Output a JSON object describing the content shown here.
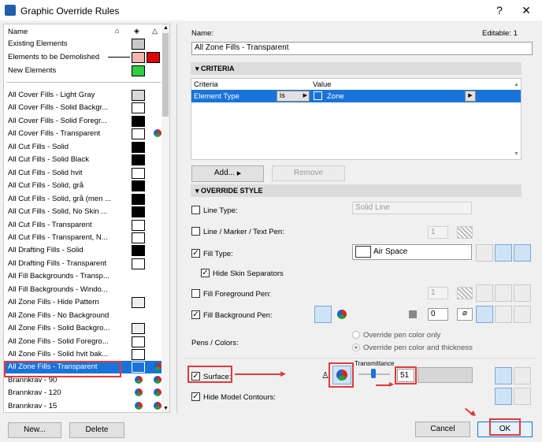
{
  "window": {
    "title": "Graphic Override Rules",
    "help": "?",
    "close": "✕"
  },
  "list": {
    "header": "Name",
    "top": [
      {
        "label": "Existing Elements",
        "swatch": "#c8c8c8"
      },
      {
        "label": "Elements to be Demolished",
        "swatch": "#f4b4b4",
        "extra": "#e00000"
      },
      {
        "label": "New Elements",
        "swatch": "#2ecc40"
      }
    ],
    "items": [
      {
        "label": "All Cover Fills - Light Gray",
        "swatch": "#d8d8d8"
      },
      {
        "label": "All Cover Fills - Solid Backgr...",
        "swatch": "#ffffff"
      },
      {
        "label": "All Cover Fills - Solid Foregr...",
        "swatch": "#000000"
      },
      {
        "label": "All Cover Fills - Transparent",
        "swatch": "#ffffff",
        "pie": true
      },
      {
        "label": "All Cut Fills - Solid",
        "swatch": "#000000"
      },
      {
        "label": "All Cut Fills - Solid Black",
        "swatch": "#000000"
      },
      {
        "label": "All Cut Fills - Solid hvit",
        "swatch": "#ffffff"
      },
      {
        "label": "All Cut Fills - Solid, grå",
        "swatch": "#000000"
      },
      {
        "label": "All Cut Fills - Solid, grå (men ...",
        "swatch": "#000000"
      },
      {
        "label": "All Cut Fills - Solid, No Skin ...",
        "swatch": "#000000"
      },
      {
        "label": "All Cut Fills - Transparent",
        "swatch": "#ffffff"
      },
      {
        "label": "All Cut Fills - Transparent, N...",
        "swatch": "#ffffff"
      },
      {
        "label": "All Drafting Fills - Solid",
        "swatch": "#000000"
      },
      {
        "label": "All Drafting Fills - Transparent",
        "swatch": "#ffffff"
      },
      {
        "label": "All Fill Backgrounds - Transp...",
        "swatch": ""
      },
      {
        "label": "All Fill Backgrounds - Windo...",
        "swatch": ""
      },
      {
        "label": "All Zone Fills - Hide Pattern",
        "swatch": "#eeeeee"
      },
      {
        "label": "All Zone Fills - No Background",
        "swatch": ""
      },
      {
        "label": "All Zone Fills - Solid Backgro...",
        "swatch": "#eeeeee"
      },
      {
        "label": "All Zone Fills - Solid Foregro...",
        "swatch": "#ffffff"
      },
      {
        "label": "All Zone Fills - Solid hvit bak...",
        "swatch": "#ffffff"
      },
      {
        "label": "All Zone Fills - Transparent",
        "swatch": "#1a73d9",
        "pie": true,
        "selected": true
      },
      {
        "label": "Brannkrav - 90",
        "swatch": "",
        "pie2": true
      },
      {
        "label": "Brannkrav - 120",
        "swatch": "",
        "pie2": true
      },
      {
        "label": "Brannkrav - 15",
        "swatch": "",
        "pie2": true
      }
    ],
    "new_btn": "New...",
    "delete_btn": "Delete"
  },
  "detail": {
    "name_label": "Name:",
    "editable": "Editable: 1",
    "name_value": "All Zone Fills - Transparent",
    "criteria_head": "CRITERIA",
    "col_criteria": "Criteria",
    "col_value": "Value",
    "crit_row": {
      "criteria": "Element Type",
      "op": "is",
      "value": "Zone"
    },
    "add_btn": "Add...",
    "remove_btn": "Remove",
    "override_head": "OVERRIDE STYLE",
    "line_type": "Line Type:",
    "line_type_val": "Solid Line",
    "pen": "Line / Marker / Text Pen:",
    "pen_val": "1",
    "fill_type": "Fill Type:",
    "fill_type_val": "Air Space",
    "hide_skin": "Hide Skin Separators",
    "fg_pen": "Fill Foreground Pen:",
    "fg_pen_val": "1",
    "bg_pen": "Fill Background Pen:",
    "bg_pen_val": "0",
    "pens_colors": "Pens / Colors:",
    "radio1": "Override pen color only",
    "radio2": "Override pen color and thickness",
    "transmittance": "Transmittance",
    "surface": "Surface:",
    "surface_val": "51",
    "hide_contours": "Hide Model Contours:",
    "cancel_btn": "Cancel",
    "ok_btn": "OK"
  },
  "colors": {
    "accent": "#1a73d9",
    "highlight": "#e03a3a"
  }
}
